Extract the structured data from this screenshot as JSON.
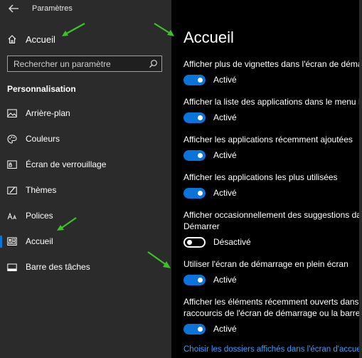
{
  "window": {
    "title": "Paramètres"
  },
  "sidebar": {
    "home_label": "Accueil",
    "search_placeholder": "Rechercher un paramètre",
    "section_title": "Personnalisation",
    "items": [
      {
        "label": "Arrière-plan",
        "icon": "image-icon"
      },
      {
        "label": "Couleurs",
        "icon": "palette-icon"
      },
      {
        "label": "Écran de verrouillage",
        "icon": "lock-screen-icon"
      },
      {
        "label": "Thèmes",
        "icon": "themes-icon"
      },
      {
        "label": "Polices",
        "icon": "fonts-icon"
      },
      {
        "label": "Accueil",
        "icon": "start-icon",
        "selected": true
      },
      {
        "label": "Barre des tâches",
        "icon": "taskbar-icon"
      }
    ]
  },
  "main": {
    "title": "Accueil",
    "settings": [
      {
        "label_lines": [
          "Afficher plus de vignettes dans l'écran de démarrage"
        ],
        "state": "Activé",
        "on": true
      },
      {
        "label_lines": [
          "Afficher la liste des applications dans le menu Démarrer"
        ],
        "state": "Activé",
        "on": true
      },
      {
        "label_lines": [
          "Afficher les applications récemment ajoutées"
        ],
        "state": "Activé",
        "on": true
      },
      {
        "label_lines": [
          "Afficher les applications les plus utilisées"
        ],
        "state": "Activé",
        "on": true
      },
      {
        "label_lines": [
          "Afficher occasionnellement des suggestions dans le menu",
          "Démarrer"
        ],
        "state": "Désactivé",
        "on": false
      },
      {
        "label_lines": [
          "Utiliser l'écran de démarrage en plein écran"
        ],
        "state": "Activé",
        "on": true
      },
      {
        "label_lines": [
          "Afficher les éléments récemment ouverts dans les listes de",
          "raccourcis de l'écran de démarrage ou la barre des tâches"
        ],
        "state": "Activé",
        "on": true
      }
    ],
    "link": "Choisir les dossiers affichés dans l'écran d'accueil"
  },
  "colors": {
    "sidebar_bg": "#2b2b2b",
    "main_bg": "#000000",
    "accent": "#0a74da",
    "link": "#3f9bff",
    "annotation_arrow": "#3ec22a"
  }
}
